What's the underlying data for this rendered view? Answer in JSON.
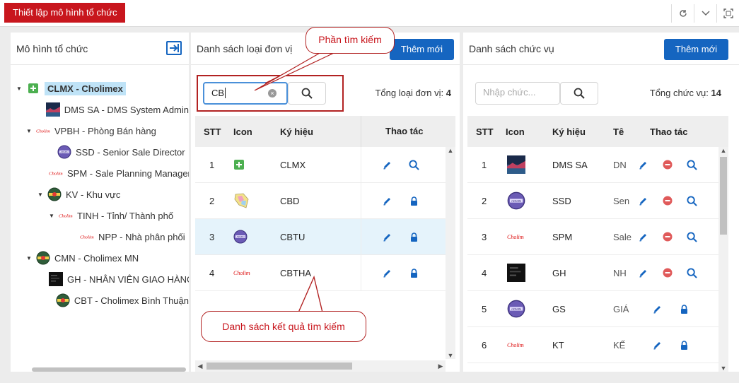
{
  "header": {
    "title": "Thiết lập mô hình tổ chức"
  },
  "left": {
    "title": "Mô hình tổ chức",
    "tree": [
      {
        "label": "CLMX - Cholimex",
        "icon": "plus-square-icon",
        "selected": true,
        "caret": true
      },
      {
        "label": "DMS SA - DMS System Admin",
        "icon": "landscape-thumbnail-icon"
      },
      {
        "label": "VPBH - Phòng Bán hàng",
        "icon": "cholimex-logo-icon",
        "caret": true
      },
      {
        "label": "SSD - Senior Sale Director",
        "icon": "admin-badge-icon"
      },
      {
        "label": "SPM - Sale Planning Manager",
        "icon": "cholimex-logo-icon"
      },
      {
        "label": "KV - Khu vực",
        "icon": "region-badge-icon",
        "caret": true
      },
      {
        "label": "TINH - Tỉnh/ Thành phố",
        "icon": "cholimex-logo-icon",
        "caret": true
      },
      {
        "label": "NPP - Nhà phân phối",
        "icon": "cholimex-logo-icon"
      },
      {
        "label": "CMN - Cholimex MN",
        "icon": "region-badge-icon",
        "caret": true
      },
      {
        "label": "GH - NHÂN VIÊN GIAO HÀNG",
        "icon": "dark-screen-icon"
      },
      {
        "label": "CBT - Cholimex Bình Thuận",
        "icon": "region-badge-icon"
      }
    ]
  },
  "middle": {
    "title": "Danh sách loại đơn vị",
    "add_label": "Thêm mới",
    "search_value": "CB",
    "total_label": "Tổng loại đơn vị:",
    "total_value": "4",
    "columns": {
      "stt": "STT",
      "icon": "Icon",
      "code": "Ký hiệu",
      "actions": "Thao tác"
    },
    "rows": [
      {
        "stt": "1",
        "icon": "plus-square-icon",
        "code": "CLMX",
        "lock": false
      },
      {
        "stt": "2",
        "icon": "map-icon",
        "code": "CBD",
        "lock": true
      },
      {
        "stt": "3",
        "icon": "admin-badge-icon",
        "code": "CBTU",
        "lock": true,
        "highlight": true
      },
      {
        "stt": "4",
        "icon": "cholimex-logo-icon",
        "code": "CBTHA",
        "lock": true
      }
    ]
  },
  "right": {
    "title": "Danh sách chức vụ",
    "add_label": "Thêm mới",
    "search_placeholder": "Nhập chức...",
    "total_label": "Tổng chức vụ:",
    "total_value": "14",
    "columns": {
      "stt": "STT",
      "icon": "Icon",
      "code": "Ký hiệu",
      "name": "Tê",
      "actions": "Thao tác"
    },
    "rows": [
      {
        "stt": "1",
        "icon": "landscape-thumbnail-icon",
        "code": "DMS SA",
        "name": "DN",
        "type": "full"
      },
      {
        "stt": "2",
        "icon": "admin-badge-icon",
        "code": "SSD",
        "name": "Sen",
        "type": "full"
      },
      {
        "stt": "3",
        "icon": "cholimex-logo-icon",
        "code": "SPM",
        "name": "Sale",
        "type": "full"
      },
      {
        "stt": "4",
        "icon": "dark-screen-icon",
        "code": "GH",
        "name": "NH",
        "type": "full"
      },
      {
        "stt": "5",
        "icon": "admin-badge-icon",
        "code": "GS",
        "name": "GIÁ",
        "type": "lock"
      },
      {
        "stt": "6",
        "icon": "cholimex-logo-icon",
        "code": "KT",
        "name": "KẾ",
        "type": "lock"
      }
    ]
  },
  "annotations": {
    "search_callout": "Phần tìm kiếm",
    "result_callout": "Danh sách kết quả tìm kiếm"
  },
  "colors": {
    "brand_red": "#c8161d",
    "primary_blue": "#1565c0",
    "annotation": "#b22222",
    "row_highlight": "#e5f3fb"
  }
}
